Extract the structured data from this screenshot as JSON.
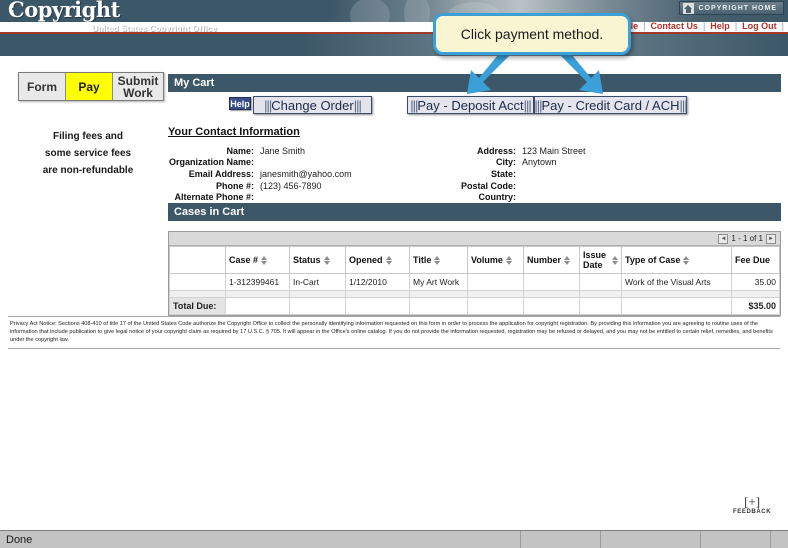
{
  "banner": {
    "logo_text": "Copyright",
    "logo_initial": "C",
    "logo_rest": "opyright",
    "subtitle": "United States Copyright Office",
    "home_button_label": "COPYRIGHT HOME",
    "home_icon": "house-icon"
  },
  "topnav": {
    "items": [
      {
        "label": "My Profile"
      },
      {
        "label": "Contact Us"
      },
      {
        "label": "Help"
      },
      {
        "label": "Log Out"
      }
    ],
    "divider": "|"
  },
  "callout": {
    "text": "Click payment method.",
    "border_color": "#3ba0d8",
    "fill_color": "#f8f6d2"
  },
  "tabs": [
    {
      "label": "Form",
      "active": false
    },
    {
      "label": "Pay",
      "active": true
    },
    {
      "label": "Submit Work",
      "active": false
    }
  ],
  "sidebar": {
    "note_line1": "Filing fees and",
    "note_line2": "some service fees",
    "note_line3": "are non-refundable"
  },
  "cart": {
    "panel_title": "My Cart",
    "help_label": "Help",
    "change_order_label": "Change Order",
    "pay_deposit_label": "Pay - Deposit Acct",
    "pay_card_label": "Pay - Credit Card / ACH",
    "grip": "|||"
  },
  "contact": {
    "title": "Your Contact Information",
    "left": [
      {
        "label": "Name:",
        "value": "Jane Smith"
      },
      {
        "label": "Organization Name:",
        "value": ""
      },
      {
        "label": "Email Address:",
        "value": "janesmith@yahoo.com"
      },
      {
        "label": "Phone #:",
        "value": "(123) 456-7890"
      },
      {
        "label": "Alternate Phone #:",
        "value": ""
      }
    ],
    "right": [
      {
        "label": "Address:",
        "value": "123 Main Street"
      },
      {
        "label": "City:",
        "value": "Anytown"
      },
      {
        "label": "State:",
        "value": ""
      },
      {
        "label": "Postal Code:",
        "value": ""
      },
      {
        "label": "Country:",
        "value": ""
      }
    ]
  },
  "cases": {
    "panel_title": "Cases in Cart",
    "pager_text": "1 - 1 of 1",
    "pager_prev": "◄",
    "pager_next": "►",
    "columns": [
      {
        "label": "",
        "sortable": false
      },
      {
        "label": "Case #",
        "sortable": true
      },
      {
        "label": "Status",
        "sortable": true
      },
      {
        "label": "Opened",
        "sortable": true
      },
      {
        "label": "Title",
        "sortable": true
      },
      {
        "label": "Volume",
        "sortable": true
      },
      {
        "label": "Number",
        "sortable": true
      },
      {
        "label": "Issue Date",
        "sortable": true
      },
      {
        "label": "Type of Case",
        "sortable": true
      },
      {
        "label": "Fee Due",
        "sortable": false
      }
    ],
    "rows": [
      {
        "select": "",
        "case_number": "1-312399461",
        "status": "In-Cart",
        "opened": "1/12/2010",
        "title": "My Art Work",
        "volume": "",
        "number": "",
        "issue_date": "",
        "type_of_case": "Work of the Visual Arts",
        "fee_due": "35.00"
      }
    ],
    "total_label": "Total Due:",
    "total_value": "$35.00"
  },
  "privacy": {
    "text": "Privacy Act Notice: Sections 408-410 of title 17 of the United States Code authorize the Copyright Office to collect the personally identifying information requested on this form in order to process the application for copyright registration. By providing this information you are agreeing to routine uses of the information that include publication to give legal notice of your copyright claim as required by 17 U.S.C. § 705. It will appear in the Office's online catalog. If you do not provide the information requested, registration may be refused or delayed, and you may not be entitled to certain relief, remedies, and benefits under the copyright law."
  },
  "feedback": {
    "plus": "[+]",
    "label": "FEEDBACK"
  },
  "statusbar": {
    "status": "Done"
  }
}
